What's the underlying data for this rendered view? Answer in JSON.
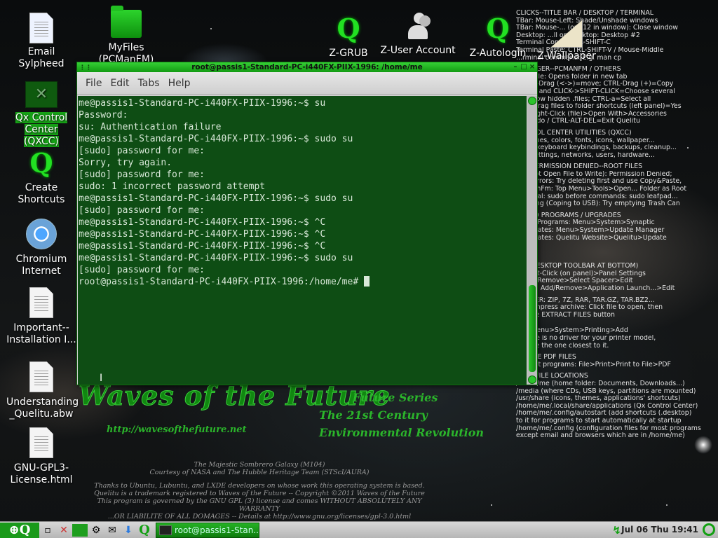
{
  "desktop_icons": [
    {
      "label": "Email Sylpheed",
      "icon": "email-icon"
    },
    {
      "label": "MyFiles (PCManFM)",
      "icon": "folder-icon"
    },
    {
      "label": "Qx Control Center (QXCC)",
      "icon": "control-center-icon"
    },
    {
      "label": "Create Shortcuts",
      "icon": "q-logo-icon"
    },
    {
      "label": "Chromium Internet",
      "icon": "chromium-icon"
    },
    {
      "label": "Important--Installation I...",
      "icon": "document-icon"
    },
    {
      "label": "Understanding _Quelitu.abw",
      "icon": "document-icon"
    },
    {
      "label": "GNU-GPL3-License.html",
      "icon": "html-file-icon"
    },
    {
      "label": "Z-GRUB",
      "icon": "q-logo-icon"
    },
    {
      "label": "Z-User Account",
      "icon": "users-icon"
    },
    {
      "label": "Z-Autologin",
      "icon": "q-logo-icon"
    },
    {
      "label": "Z-Wallpaper",
      "icon": "wallpaper-icon"
    }
  ],
  "help_text": [
    "CLICKS--TITLE BAR / DESKTOP / TERMINAL",
    "TBar: Mouse-Left: Shade/Unshade windows",
    "TBar: Mouse-... (or F12 in window): Close window",
    "Desktop: ...ll on Desktop: Desktop #2",
    "Terminal Copy: CTRL-SHIFT-C",
    "Terminal Paste: CTRL-SHIFT-V / Mouse-Middle",
    "...rminal command: E.g. man cp",
    "",
    "...ANAGER--PCMANFM / OTHERS",
    "...Middle: Opens folder in new tab",
    "...HIFT-Drag (<->)=move; CTRL-Drag (+)=Copy",
    "...LICK and CLICK->SHIFT-CLICK=Choose several",
    "...=Show hidden .files; CTRL-a=Select all",
    "...RL-Drag files to folder shortcuts (left panel)=Yes",
    "...s: Right-Click (file)>Open With>Accessories",
    "...=Undo / CTRL-ALT-DEL=Exit Quelitu",
    "",
    "...NTROL CENTER UTILITIES (QXCC)",
    "...themes, colors, fonts, icons, wallpaper...",
    "...uts, keyboard keybindings, backups, cleanup...",
    "...re settings, networks, users, hardware...",
    "",
    "...S: PERMISSION DENIED--ROOT FILES",
    "...annot Open File to Write): Permission Denied;",
    "...py Errors: Try deleting first and use Copy&Paste,",
    "...CManFm: Top Menu>Tools>Open... Folder as Root",
    "...rminal: sudo before commands: sudo leafpad...",
    "...plicing (Coping to USB): Try emptying Trash Can",
    "",
    "... ADD PROGRAMS / UPGRADES",
    "...Add Programs: Menu>System>Synaptic",
    "... Updates: Menu>System>Update Manager",
    "... Updates: Quelitu Website>Quelitu>Update",
    "",
    "",
    "",
    "",
    "",
    "...E (DESKTOP TOOLBAR AT BOTTOM)",
    "...Right-Click (on panel)>Panel Settings",
    "...Add/Remove>Select Spacer>Edit",
    "...ams: Add/Remove>Application Launch...>Edit",
    "",
    "...OLLER: ZIP, 7Z, RAR, TAR.GZ, TAR.BZ2...",
    "...ecompress archive: Click file to open, then",
    "...n the EXTRACT FILES button",
    "",
    "",
    "...R: Menu>System>Printing>Add",
    "If there is no driver for your printer model,",
    "choose the one closest to it.",
    "",
    "CREATE PDF FILES",
    "In most programs: File>Print>Print to File>PDF",
    "",
    "MAIN FILE LOCATIONS",
    "/home/me (home folder: Documents, Downloads...)",
    "/media (where CDs, USB keys, partitions are mounted)",
    "/usr/share (icons, themes, applications' shortcuts)",
    "/home/me/.local/share/applications (Qx Control Center)",
    "/home/me/.config/autostart (add shortcuts (.desktop)",
    "to it for programs to start automatically at startup",
    "/home/me/.config (configuration files for most programs",
    "except email and browsers which are in /home/me)"
  ],
  "wallpaper": {
    "title": "Waves of the Future",
    "url": "http://wavesofthefuture.net",
    "tagline": [
      "Future Series",
      "The 21st Century",
      "Environmental Revolution"
    ],
    "credits": [
      "The Majestic Sombrero Galaxy (M104)",
      "Courtesy of NASA and The Hubble Heritage Team (STScI/AURA)",
      "",
      "Thanks to Ubuntu, Lubuntu, and LXDE developers on whose work this operating system is based.",
      "Quelitu is a trademark registered to Waves of the Future -- Copyright ©2011 Waves of the Future",
      "This program is governed by the GNU GPL (3) license and comes WITHOUT ABSOLUTELY ANY WARRANTY",
      "...OR LIABILITE OF ALL DOMAGES -- Details at http://www.gnu.org/licenses/gpl-3.0.html"
    ]
  },
  "terminal": {
    "title": "root@passis1-Standard-PC-i440FX-PIIX-1996: /home/me",
    "menu": [
      "File",
      "Edit",
      "Tabs",
      "Help"
    ],
    "lines": [
      "me@passis1-Standard-PC-i440FX-PIIX-1996:~$ su",
      "Password:",
      "su: Authentication failure",
      "me@passis1-Standard-PC-i440FX-PIIX-1996:~$ sudo su",
      "[sudo] password for me:",
      "Sorry, try again.",
      "[sudo] password for me:",
      "sudo: 1 incorrect password attempt",
      "me@passis1-Standard-PC-i440FX-PIIX-1996:~$ sudo su",
      "[sudo] password for me:",
      "me@passis1-Standard-PC-i440FX-PIIX-1996:~$ ^C",
      "me@passis1-Standard-PC-i440FX-PIIX-1996:~$ ^C",
      "me@passis1-Standard-PC-i440FX-PIIX-1996:~$ ^C",
      "me@passis1-Standard-PC-i440FX-PIIX-1996:~$ sudo su",
      "[sudo] password for me:"
    ],
    "prompt": "root@passis1-Standard-PC-i440FX-PIIX-1996:/home/me# "
  },
  "taskbar": {
    "task_label": "root@passis1-Stan...",
    "clock": "Jul 06 Thu 19:41"
  },
  "colors": {
    "accent": "#16a016",
    "terminal_bg": "#0e4d14"
  }
}
